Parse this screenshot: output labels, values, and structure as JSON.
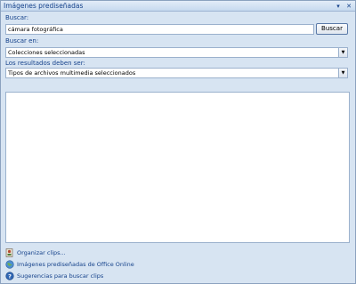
{
  "pane": {
    "title": "Imágenes prediseñadas",
    "dropdown_glyph": "▾",
    "close_glyph": "✕"
  },
  "search": {
    "label": "Buscar:",
    "value": "cámara fotográfica",
    "button_label": "Buscar"
  },
  "search_in": {
    "label": "Buscar en:",
    "selected": "Colecciones seleccionadas"
  },
  "results_type": {
    "label": "Los resultados deben ser:",
    "selected": "Tipos de archivos multimedia seleccionados"
  },
  "links": [
    {
      "label": "Organizar clips...",
      "icon": "organize-clips-icon"
    },
    {
      "label": "Imágenes prediseñadas de Office Online",
      "icon": "office-online-icon"
    },
    {
      "label": "Sugerencias para buscar clips",
      "icon": "help-icon"
    }
  ],
  "colors": {
    "accent": "#15428b",
    "pane_background": "#d7e4f2",
    "border": "#9bb1cd"
  }
}
